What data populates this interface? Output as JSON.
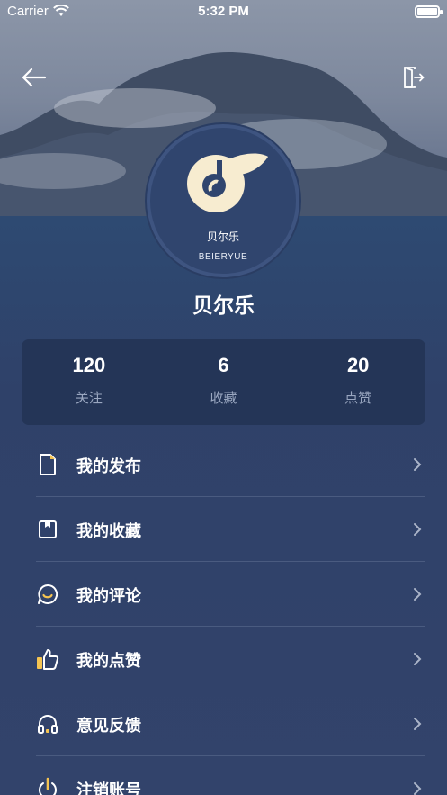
{
  "status_bar": {
    "carrier": "Carrier",
    "time": "5:32 PM"
  },
  "header": {
    "back_icon": "arrow-left-icon",
    "exit_icon": "exit-door-icon"
  },
  "avatar": {
    "name_cn": "贝尔乐",
    "name_en": "BEIERYUE"
  },
  "profile": {
    "username": "贝尔乐"
  },
  "stats": [
    {
      "value": "120",
      "label": "关注"
    },
    {
      "value": "6",
      "label": "收藏"
    },
    {
      "value": "20",
      "label": "点赞"
    }
  ],
  "menu": [
    {
      "label": "我的发布",
      "icon": "document-icon"
    },
    {
      "label": "我的收藏",
      "icon": "bookmark-icon"
    },
    {
      "label": "我的评论",
      "icon": "comment-icon"
    },
    {
      "label": "我的点赞",
      "icon": "thumbs-up-icon"
    },
    {
      "label": "意见反馈",
      "icon": "headphones-icon"
    },
    {
      "label": "注销账号",
      "icon": "power-icon"
    }
  ],
  "colors": {
    "accent": "#f5c451",
    "background": "#2f4169",
    "card": "#243557"
  }
}
